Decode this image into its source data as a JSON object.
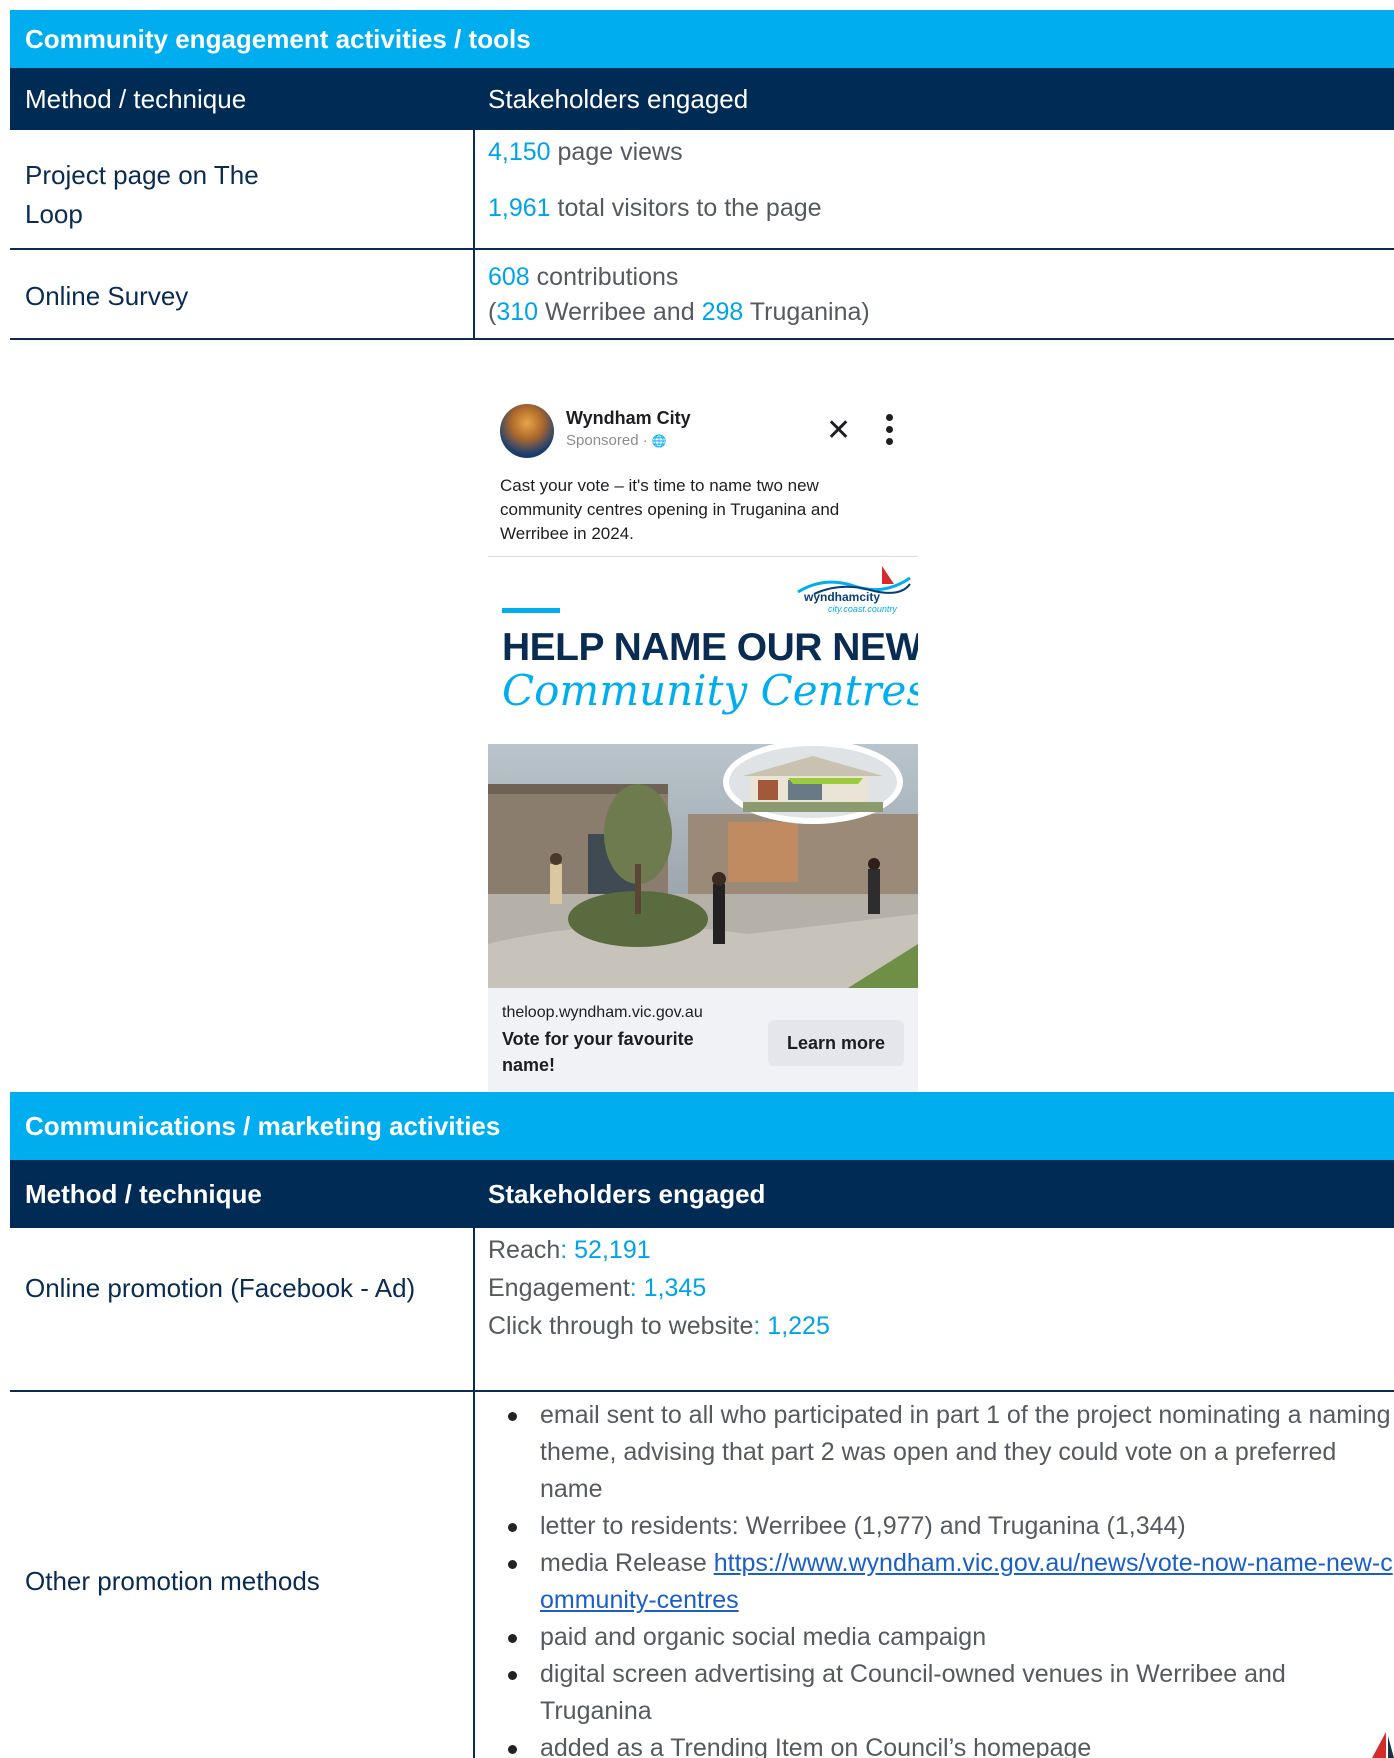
{
  "engagement": {
    "section_title": "Community engagement activities / tools",
    "col_method": "Method / technique",
    "col_stakeholders": "Stakeholders engaged",
    "rows": [
      {
        "method_line1": "Project page on The",
        "method_line2": "Loop",
        "stat1_num": "4,150",
        "stat1_text": " page views",
        "stat2_num": "1,961",
        "stat2_text": " total visitors to the page"
      },
      {
        "method": "Online Survey",
        "contrib_num": "608",
        "contrib_text": " contributions",
        "paren_open": "(",
        "werribee_num": "310",
        "werribee_text": " Werribee and ",
        "truganina_num": "298",
        "truganina_text": " Truganina)"
      }
    ]
  },
  "facebook_ad": {
    "page_name": "Wyndham City",
    "sponsored": "Sponsored · ",
    "globe_glyph": "🌐",
    "close_glyph": "✕",
    "caption": "Cast your vote – it's time to name two new community centres opening in Truganina and Werribee in 2024.",
    "logo_text": "wyndhamcity",
    "logo_tagline": "city.coast.country",
    "headline": "HELP NAME OUR NEW",
    "script_headline": "Community Centres",
    "domain": "theloop.wyndham.vic.gov.au",
    "cta_text": "Vote for your favourite name!",
    "button_label": "Learn more"
  },
  "communications": {
    "section_title": "Communications / marketing activities",
    "col_method": "Method / technique",
    "col_stakeholders": "Stakeholders engaged",
    "facebook_row": {
      "method": "Online promotion (Facebook - Ad)",
      "reach_label": "Reach",
      "reach_value": ": 52,191",
      "engagement_label": "Engagement",
      "engagement_value": ": 1,345",
      "clicks_label": "Click through to website",
      "clicks_value": ": 1,225"
    },
    "other_row": {
      "method": "Other promotion methods",
      "bullet1": "email sent to all who participated in part 1 of the project nominating a naming theme, advising that part 2 was open and they could vote on a preferred name",
      "bullet2": "letter to residents: Werribee (1,977) and Truganina (1,344)",
      "bullet3_prefix": "media Release ",
      "bullet3_link": "https://www.wyndham.vic.gov.au/news/vote-now-name-new-community-centres",
      "bullet4": "paid and organic social media campaign",
      "bullet5": "digital screen advertising at Council-owned venues in Werribee and Truganina",
      "bullet6": "added as a Trending Item on Council’s homepage"
    }
  },
  "colors": {
    "band": "#00aeef",
    "header": "#002b55",
    "highlight_number": "#00a3e8",
    "body_text": "#555a60",
    "label_text": "#0b2c52"
  }
}
